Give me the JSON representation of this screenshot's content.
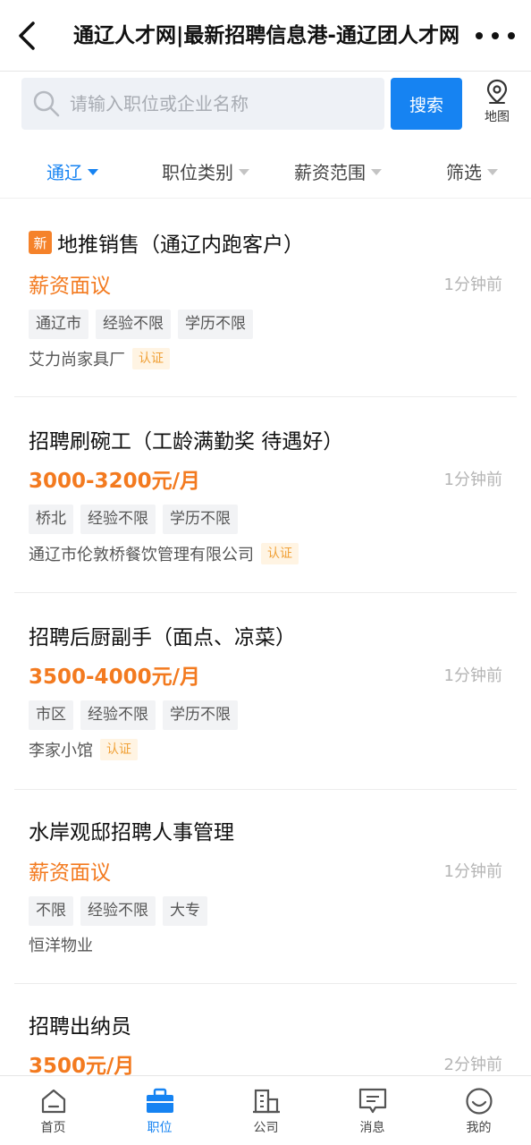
{
  "header": {
    "title": "通辽人才网|最新招聘信息港-通辽团人才网"
  },
  "search": {
    "placeholder": "请输入职位或企业名称",
    "button_label": "搜索",
    "map_label": "地图"
  },
  "filters": [
    {
      "label": "通辽",
      "active": true
    },
    {
      "label": "职位类别",
      "active": false
    },
    {
      "label": "薪资范围",
      "active": false
    },
    {
      "label": "筛选",
      "active": false
    }
  ],
  "jobs": [
    {
      "title": "地推销售（通辽内跑客户）",
      "is_new": true,
      "new_label": "新",
      "salary": "薪资面议",
      "time": "1分钟前",
      "tags": [
        "通辽市",
        "经验不限",
        "学历不限"
      ],
      "company": "艾力尚家具厂",
      "certified": true,
      "cert_label": "认证"
    },
    {
      "title": "招聘刷碗工（工龄满勤奖 待遇好）",
      "is_new": false,
      "salary": "3000-3200元/月",
      "time": "1分钟前",
      "tags": [
        "桥北",
        "经验不限",
        "学历不限"
      ],
      "company": "通辽市伦敦桥餐饮管理有限公司",
      "certified": true,
      "cert_label": "认证"
    },
    {
      "title": "招聘后厨副手（面点、凉菜）",
      "is_new": false,
      "salary": "3500-4000元/月",
      "time": "1分钟前",
      "tags": [
        "市区",
        "经验不限",
        "学历不限"
      ],
      "company": "李家小馆",
      "certified": true,
      "cert_label": "认证"
    },
    {
      "title": "水岸观邸招聘人事管理",
      "is_new": false,
      "salary": "薪资面议",
      "time": "1分钟前",
      "tags": [
        "不限",
        "经验不限",
        "大专"
      ],
      "company": "恒洋物业",
      "certified": false
    },
    {
      "title": "招聘出纳员",
      "is_new": false,
      "salary": "3500元/月",
      "time": "2分钟前",
      "tags": [],
      "company": "",
      "certified": false
    }
  ],
  "tabbar": [
    {
      "label": "首页",
      "icon": "home-icon",
      "active": false
    },
    {
      "label": "职位",
      "icon": "briefcase-icon",
      "active": true
    },
    {
      "label": "公司",
      "icon": "building-icon",
      "active": false
    },
    {
      "label": "消息",
      "icon": "message-icon",
      "active": false
    },
    {
      "label": "我的",
      "icon": "smile-icon",
      "active": false
    }
  ],
  "colors": {
    "accent": "#1683f2",
    "salary": "#f37a1f",
    "new_badge": "#f5822a",
    "cert_text": "#f0a036"
  }
}
